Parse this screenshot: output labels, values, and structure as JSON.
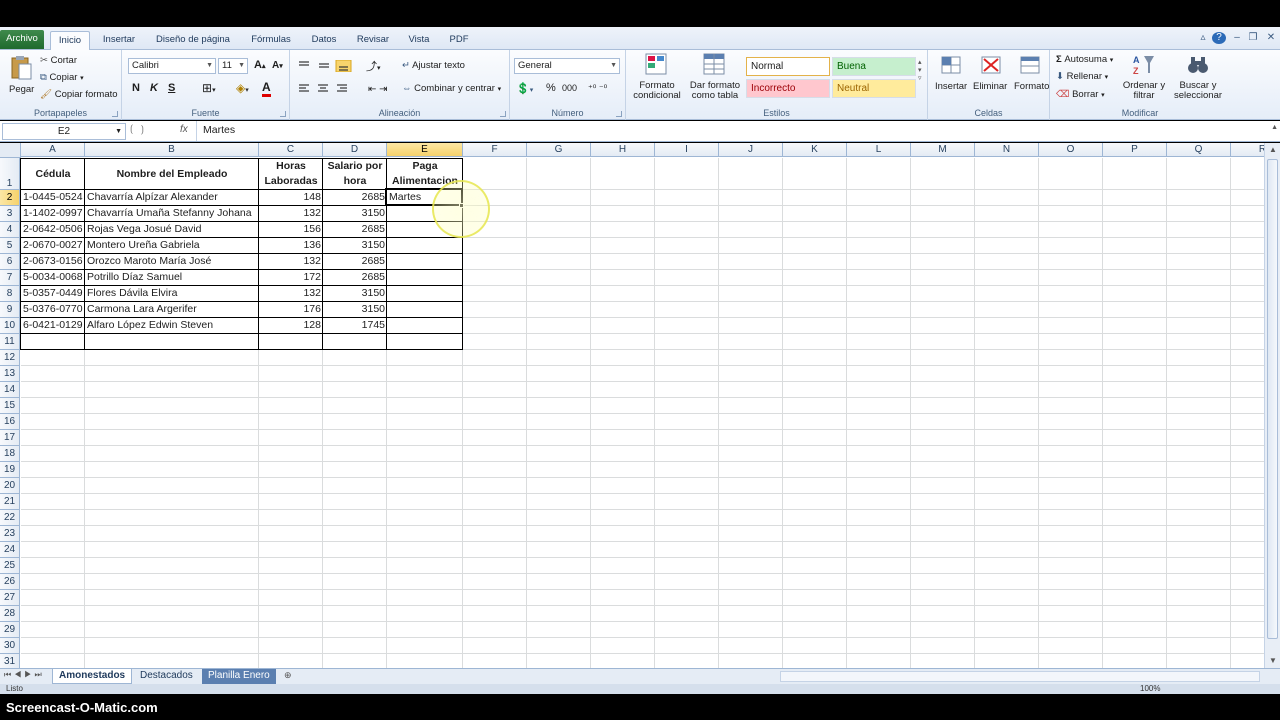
{
  "ribbon_tabs": [
    "Archivo",
    "Inicio",
    "Insertar",
    "Diseño de página",
    "Fórmulas",
    "Datos",
    "Revisar",
    "Vista",
    "PDF"
  ],
  "clipboard": {
    "paste": "Pegar",
    "cut": "Cortar",
    "copy": "Copiar",
    "format_painter": "Copiar formato",
    "label": "Portapapeles"
  },
  "font": {
    "name": "Calibri",
    "size": "11",
    "label": "Fuente",
    "bold": "N",
    "italic": "K",
    "underline": "S"
  },
  "alignment": {
    "wrap": "Ajustar texto",
    "merge": "Combinar y centrar",
    "label": "Alineación"
  },
  "number": {
    "format": "General",
    "percent": "%",
    "thousands": "000",
    "label": "Número"
  },
  "styles": {
    "cond_format": "Formato condicional",
    "table_format": "Dar formato como tabla",
    "normal": "Normal",
    "good": "Buena",
    "bad": "Incorrecto",
    "neutral": "Neutral",
    "label": "Estilos"
  },
  "cells": {
    "insert": "Insertar",
    "delete": "Eliminar",
    "format": "Formato",
    "label": "Celdas"
  },
  "editing": {
    "autosum": "Autosuma",
    "fill": "Rellenar",
    "clear": "Borrar",
    "sort": "Ordenar y filtrar",
    "find": "Buscar y seleccionar",
    "label": "Modificar"
  },
  "formula_bar": {
    "name_box": "E2",
    "fx": "fx",
    "content": "Martes"
  },
  "columns": [
    "A",
    "B",
    "C",
    "D",
    "E",
    "F",
    "G",
    "H",
    "I",
    "J",
    "K",
    "L",
    "M",
    "N",
    "O",
    "P",
    "Q",
    "R"
  ],
  "rows": [
    "1",
    "2",
    "3",
    "4",
    "5",
    "6",
    "7",
    "8",
    "9",
    "10",
    "11",
    "12",
    "13",
    "14",
    "15",
    "16",
    "17",
    "18",
    "19",
    "20",
    "21",
    "22",
    "23",
    "24",
    "25",
    "26",
    "27",
    "28",
    "29",
    "30",
    "31"
  ],
  "table": {
    "headers": [
      "Cédula",
      "Nombre del Empleado",
      "Horas Laboradas",
      "Salario por hora",
      "Paga Alimentacion"
    ],
    "rows": [
      [
        "1-0445-0524",
        "Chavarría Alpízar Alexander",
        "148",
        "2685",
        "Martes"
      ],
      [
        "1-1402-0997",
        "Chavarría Umaña Stefanny Johana",
        "132",
        "3150",
        ""
      ],
      [
        "2-0642-0506",
        "Rojas Vega Josué David",
        "156",
        "2685",
        ""
      ],
      [
        "2-0670-0027",
        "Montero Ureña Gabriela",
        "136",
        "3150",
        ""
      ],
      [
        "2-0673-0156",
        "Orozco Maroto María José",
        "132",
        "2685",
        ""
      ],
      [
        "5-0034-0068",
        "Potrillo Díaz Samuel",
        "172",
        "2685",
        ""
      ],
      [
        "5-0357-0449",
        "Flores Dávila Elvira",
        "132",
        "3150",
        ""
      ],
      [
        "5-0376-0770",
        "Carmona Lara Argerifer",
        "176",
        "3150",
        ""
      ],
      [
        "6-0421-0129",
        "Alfaro López Edwin Steven",
        "128",
        "1745",
        ""
      ]
    ]
  },
  "sheets": [
    "Amonestados",
    "Destacados",
    "Planilla Enero"
  ],
  "status": {
    "ready": "Listo",
    "zoom": "100%"
  },
  "watermark": "Screencast-O-Matic.com",
  "colors": {
    "selection": "#f6d26b",
    "file_tab": "#2e7d3a",
    "accent": "#1e395b"
  }
}
